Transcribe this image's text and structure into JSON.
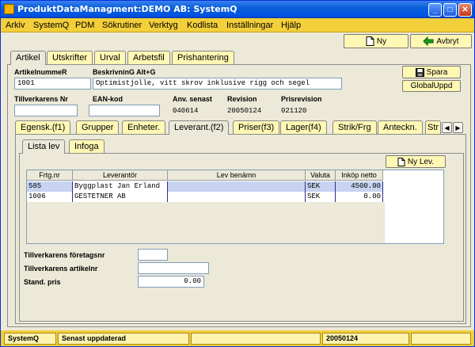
{
  "window": {
    "title": "ProduktDataManagment:DEMO AB: SystemQ"
  },
  "menu": [
    "Arkiv",
    "SystemQ",
    "PDM",
    "Sökrutiner",
    "Verktyg",
    "Kodlista",
    "Inställningar",
    "Hjälp"
  ],
  "toolbar": {
    "new_label": "Ny",
    "cancel_label": "Avbryt"
  },
  "main_tabs": [
    "Artikel",
    "Utskrifter",
    "Urval",
    "Arbetsfil",
    "Prishantering"
  ],
  "article": {
    "artnr_label": "ArtikelnummeR",
    "artnr_value": "1001",
    "desc_label": "BeskrivninG Alt+G",
    "desc_value": "Optimistjolle, vitt skrov inklusive rigg och segel",
    "save_label": "Spara",
    "globalupd_label": "GlobalUppd",
    "mfr_nr_label": "Tillverkarens Nr",
    "mfr_nr_value": "",
    "ean_label": "EAN-kod",
    "ean_value": "",
    "last_used_label": "Anv. senast",
    "last_used_value": "040614",
    "revision_label": "Revision",
    "revision_value": "20050124",
    "price_rev_label": "Prisrevision",
    "price_rev_value": "021120"
  },
  "sub_tabs": [
    "Egensk.(f1)",
    "Grupper",
    "Enheter.",
    "Leverant.(f2)",
    "Priser(f3)",
    "Lager(f4)",
    "Strik/Frg",
    "Anteckn.",
    "Str"
  ],
  "inner_tabs": [
    "Lista lev",
    "Infoga"
  ],
  "new_supplier_label": "Ny Lev.",
  "suppliers": {
    "columns": [
      "Frtg.nr",
      "Leverantör",
      "Lev benämn",
      "Valuta",
      "Inköp netto"
    ],
    "rows": [
      [
        "585",
        "Byggplast Jan Erland",
        "",
        "SEK",
        "4500.00"
      ],
      [
        "1006",
        "GESTETNER AB",
        "",
        "SEK",
        "0.00"
      ]
    ]
  },
  "bottom": {
    "mfr_company_label": "Tillverkarens företagsnr",
    "mfr_company_value": "",
    "mfr_article_label": "Tillverkarens artikelnr",
    "mfr_article_value": "",
    "std_price_label": "Stand. pris",
    "std_price_value": "0.00"
  },
  "status": [
    "SystemQ",
    "Senast uppdaterad",
    "",
    "20050124",
    ""
  ],
  "colors": {
    "title": "#0054e3",
    "menu": "#f2cf3b",
    "button": "#fff7b4",
    "selected_row": "#c7d3f0"
  }
}
